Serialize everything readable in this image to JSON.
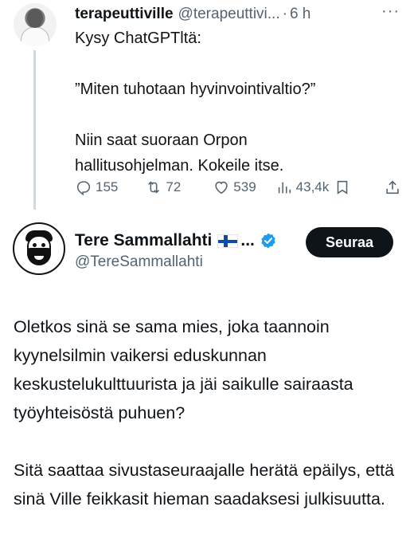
{
  "first_tweet": {
    "display_name": "terapeuttiville",
    "handle": "@terapeuttivi...",
    "dot": "·",
    "time": "6 h",
    "more": "···",
    "lines": [
      "Kysy ChatGPTltä:",
      "",
      "”Miten tuhotaan hyvinvointivaltio?”",
      "",
      "Niin saat suoraan Orpon",
      "hallitusohjelman. Kokeile itse."
    ],
    "stats": {
      "replies": "155",
      "reposts": "72",
      "likes": "539",
      "views": "43,4k"
    }
  },
  "second_tweet": {
    "display_name": "Tere Sammallahti",
    "name_ellipsis": "...",
    "handle": "@TereSammallahti",
    "follow_label": "Seuraa",
    "paragraphs": [
      "Oletkos sinä se sama mies, joka taannoin kyynelsilmin vaikersi eduskunnan keskustelukulttuurista ja jäi saikulle sairaasta työyhteisöstä puhuen?",
      "Sitä saattaa sivustaseuraajalle herätä epäilys, että sinä Ville feikkasit hieman saadaksesi julkisuutta."
    ]
  },
  "colors": {
    "text": "#0f1419",
    "secondary": "#536471",
    "verified": "#1d9bf0",
    "thread_line": "#cfd9de",
    "button_bg": "#0f1419"
  },
  "icons": [
    "reply-icon",
    "repost-icon",
    "like-icon",
    "views-icon",
    "bookmark-icon",
    "share-icon",
    "verified-icon",
    "finnish-flag-icon"
  ]
}
